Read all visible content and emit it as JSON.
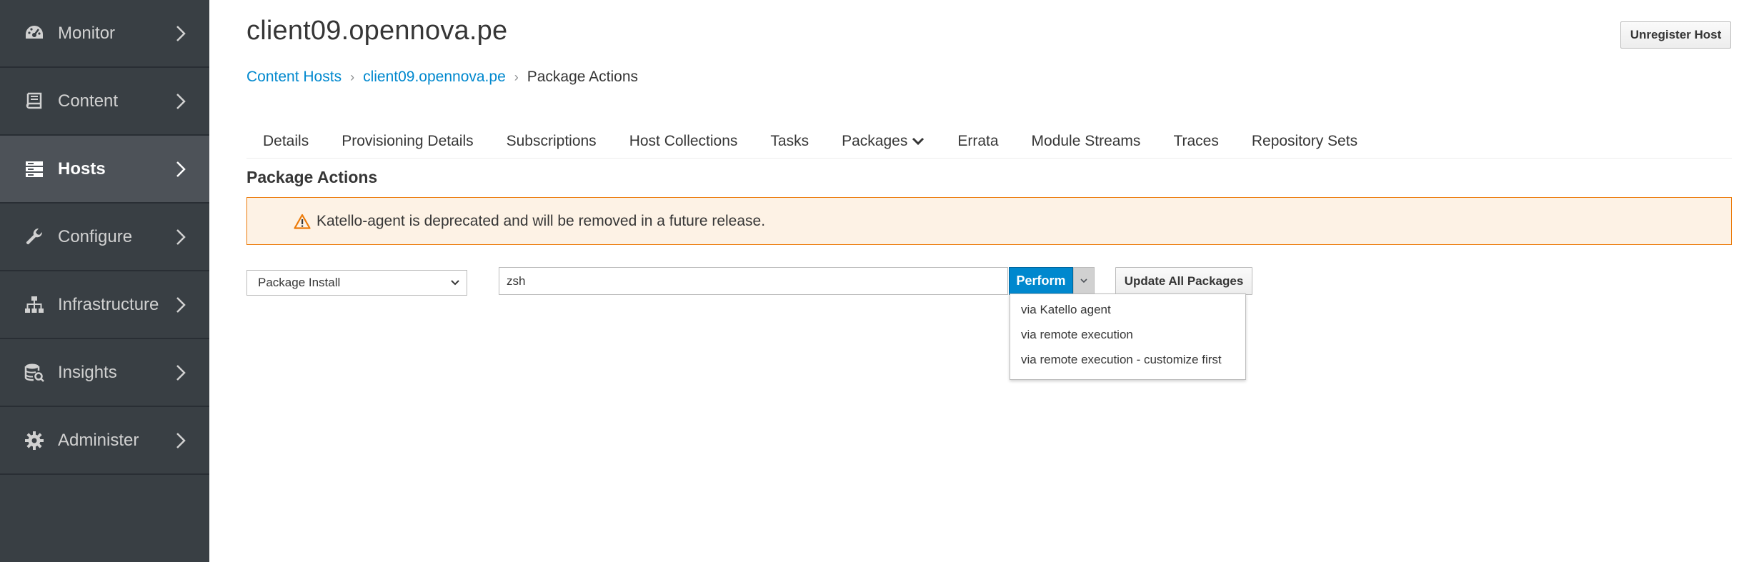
{
  "sidebar": {
    "items": [
      {
        "label": "Monitor",
        "icon": "dashboard-icon"
      },
      {
        "label": "Content",
        "icon": "book-icon"
      },
      {
        "label": "Hosts",
        "icon": "server-icon",
        "active": true
      },
      {
        "label": "Configure",
        "icon": "wrench-icon"
      },
      {
        "label": "Infrastructure",
        "icon": "network-icon"
      },
      {
        "label": "Insights",
        "icon": "database-search-icon"
      },
      {
        "label": "Administer",
        "icon": "gear-icon"
      }
    ]
  },
  "header": {
    "title": "client09.opennova.pe",
    "unregister_label": "Unregister Host"
  },
  "breadcrumb": {
    "items": [
      "Content Hosts",
      "client09.opennova.pe",
      "Package Actions"
    ]
  },
  "tabs": [
    {
      "label": "Details"
    },
    {
      "label": "Provisioning Details"
    },
    {
      "label": "Subscriptions"
    },
    {
      "label": "Host Collections"
    },
    {
      "label": "Tasks"
    },
    {
      "label": "Packages"
    },
    {
      "label": "Errata"
    },
    {
      "label": "Module Streams"
    },
    {
      "label": "Traces"
    },
    {
      "label": "Repository Sets"
    }
  ],
  "section_title": "Package Actions",
  "alert": {
    "text": "Katello-agent is deprecated and will be removed in a future release."
  },
  "actions": {
    "selected": "Package Install",
    "input_value": "zsh",
    "perform_label": "Perform",
    "update_all_label": "Update All Packages",
    "menu": [
      "via Katello agent",
      "via remote execution",
      "via remote execution - customize first"
    ]
  },
  "colors": {
    "sidebar_bg": "#393f44",
    "sidebar_active": "#4d5258",
    "link": "#0088ce",
    "primary": "#0088ce",
    "alert_bg": "#fdf2e5",
    "alert_border": "#ec7a08"
  }
}
